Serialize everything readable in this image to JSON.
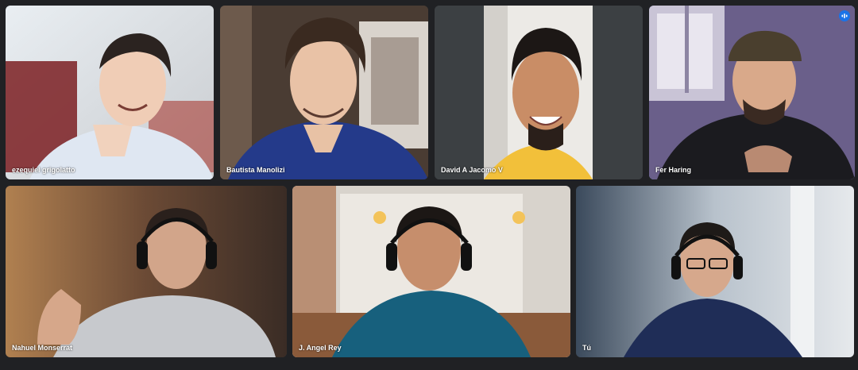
{
  "participants": [
    {
      "name": "ezequiel grigolatto",
      "speaking": false
    },
    {
      "name": "Bautista Manolizi",
      "speaking": false
    },
    {
      "name": "David A Jacomo V",
      "speaking": false
    },
    {
      "name": "Fer Haring",
      "speaking": true
    },
    {
      "name": "Nahuel Monserrat",
      "speaking": false
    },
    {
      "name": "J. Angel Rey",
      "speaking": false
    },
    {
      "name": "Tú",
      "speaking": false
    }
  ],
  "icons": {
    "speaking_indicator": "audio-waves-icon"
  },
  "colors": {
    "background": "#202124",
    "speaking_border": "#8ab4f8",
    "badge": "#1a73e8"
  }
}
